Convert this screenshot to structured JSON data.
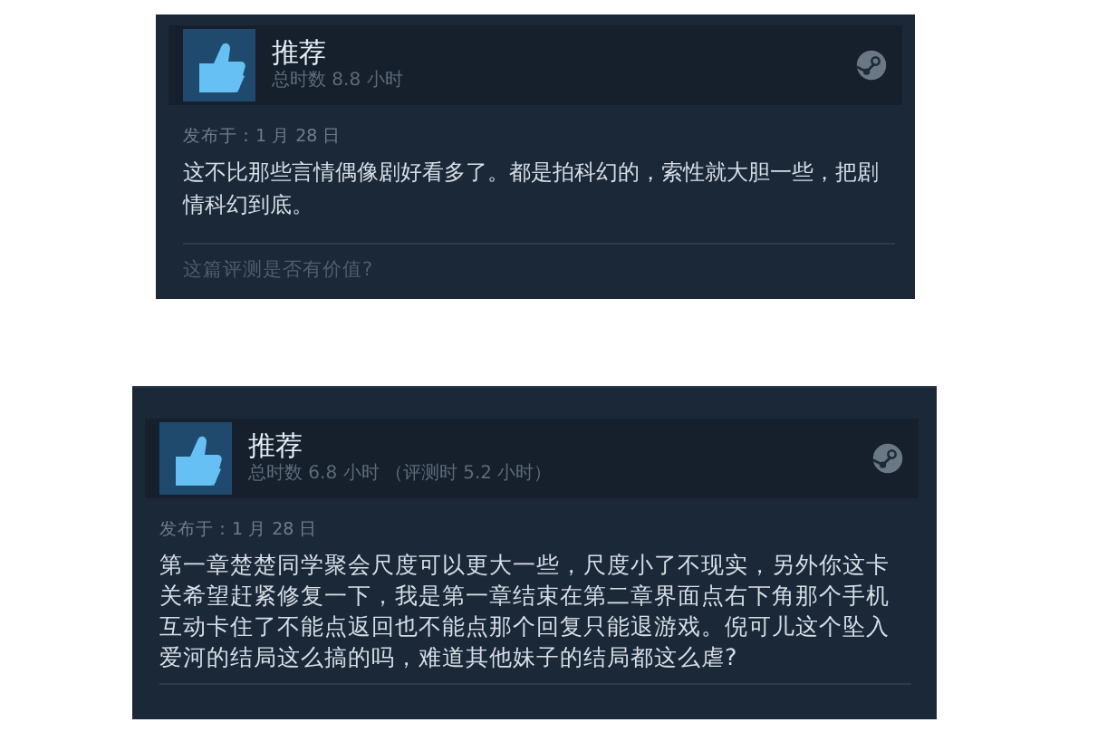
{
  "reviews": [
    {
      "verdict": "推荐",
      "hours": "总时数 8.8 小时",
      "posted": "发布于：1 月 28 日",
      "body": "这不比那些言情偶像剧好看多了。都是拍科幻的，索性就大胆一些，把剧情科幻到底。",
      "helpful_prompt": "这篇评测是否有价值?"
    },
    {
      "verdict": "推荐",
      "hours": "总时数 6.8 小时 （评测时 5.2 小时）",
      "posted": "发布于：1 月 28 日",
      "body": "第一章楚楚同学聚会尺度可以更大一些，尺度小了不现实，另外你这卡关希望赶紧修复一下，我是第一章结束在第二章界面点右下角那个手机互动卡住了不能点返回也不能点那个回复只能退游戏。倪可儿这个坠入爱河的结局这么搞的吗，难道其他妹子的结局都这么虐?"
    }
  ]
}
